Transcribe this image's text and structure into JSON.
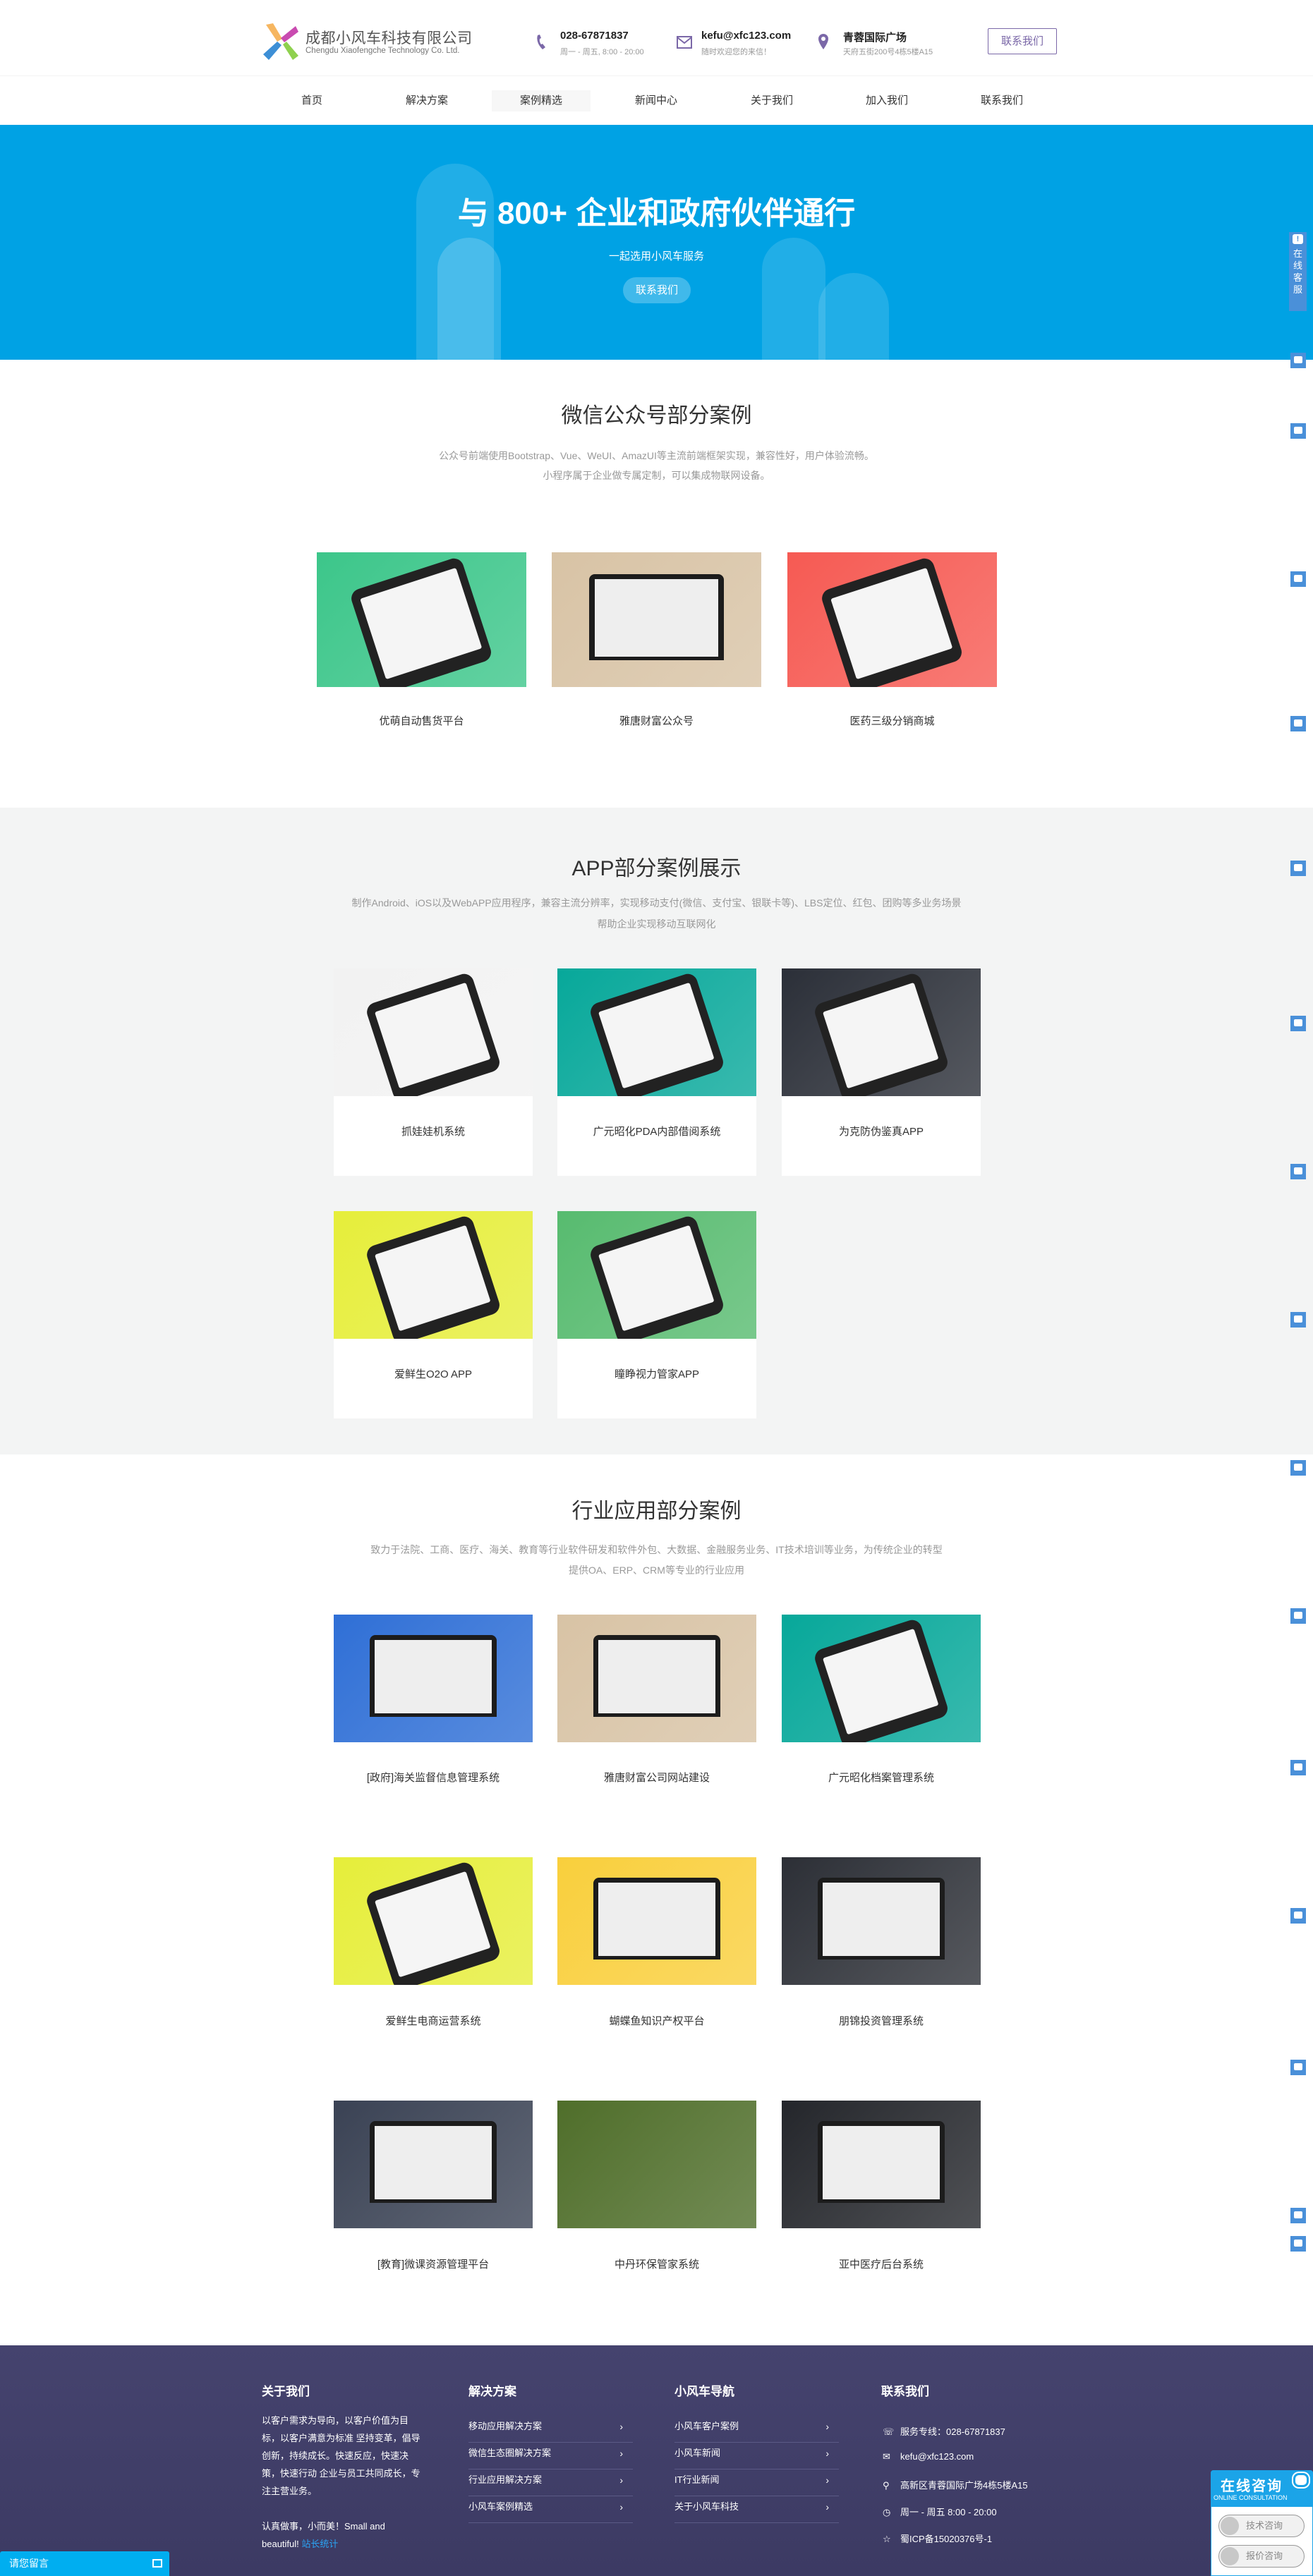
{
  "header": {
    "company_name": "成都小风车科技有限公司",
    "company_en": "Chengdu Xiaofengche Technology Co. Ltd.",
    "phone": "028-67871837",
    "phone_hours": "周一 - 周五, 8:00 - 20:00",
    "email": "kefu@xfc123.com",
    "email_note": "随时欢迎您的来信！",
    "location": "青蓉国际广场",
    "address": "天府五街200号4栋5楼A15",
    "contact_button": "联系我们"
  },
  "nav": {
    "items": [
      "首页",
      "解决方案",
      "案例精选",
      "新闻中心",
      "关于我们",
      "加入我们",
      "联系我们"
    ],
    "active_index": 2
  },
  "hero": {
    "title": "与 800+ 企业和政府伙伴通行",
    "subtitle": "一起选用小风车服务",
    "button": "联系我们"
  },
  "wechat_section": {
    "title": "微信公众号部分案例",
    "desc": [
      "公众号前端使用Bootstrap、Vue、WeUI、AmazUI等主流前端框架实现，兼容性好，用户体验流畅。",
      "小程序属于企业做专属定制，可以集成物联网设备。"
    ],
    "cases": [
      {
        "label": "优萌自动售货平台",
        "color": "#3cc68a",
        "style": "phone"
      },
      {
        "label": "雅唐财富公众号",
        "color": "#d8c3a5",
        "style": "laptop"
      },
      {
        "label": "医药三级分销商城",
        "color": "#f65a53",
        "style": "phone"
      }
    ]
  },
  "app_section": {
    "title": "APP部分案例展示",
    "desc": [
      "制作Android、iOS以及WebAPP应用程序，兼容主流分辨率，实现移动支付(微信、支付宝、银联卡等)、LBS定位、红包、团购等多业务场景",
      "帮助企业实现移动互联网化"
    ],
    "cases": [
      {
        "label": "抓娃娃机系统",
        "color": "#f2f2f2",
        "style": "phone"
      },
      {
        "label": "广元昭化PDA内部借阅系统",
        "color": "#07a89a",
        "style": "phone"
      },
      {
        "label": "为克防伪鉴真APP",
        "color": "#2b2f38",
        "style": "phone"
      },
      {
        "label": "爱鲜生O2O APP",
        "color": "#e6ee3a",
        "style": "phone"
      },
      {
        "label": "瞳睁视力管家APP",
        "color": "#57bb6f",
        "style": "phone"
      }
    ]
  },
  "industry_section": {
    "title": "行业应用部分案例",
    "desc": [
      "致力于法院、工商、医疗、海关、教育等行业软件研发和软件外包、大数据、金融服务业务、IT技术培训等业务，为传统企业的转型",
      "提供OA、ERP、CRM等专业的行业应用"
    ],
    "cases": [
      {
        "label": "[政府]海关监督信息管理系统",
        "color": "#2f6fd6",
        "style": "laptop"
      },
      {
        "label": "雅唐财富公司网站建设",
        "color": "#d8c3a5",
        "style": "laptop"
      },
      {
        "label": "广元昭化档案管理系统",
        "color": "#07a89a",
        "style": "phone"
      },
      {
        "label": "爱鲜生电商运营系统",
        "color": "#e6ee3a",
        "style": "phone"
      },
      {
        "label": "蝴蝶鱼知识产权平台",
        "color": "#f9cf3c",
        "style": "laptop"
      },
      {
        "label": "朋锦投资管理系统",
        "color": "#2c2f36",
        "style": "laptop"
      },
      {
        "label": "[教育]微课资源管理平台",
        "color": "#3a4254",
        "style": "laptop"
      },
      {
        "label": "中丹环保管家系统",
        "color": "#4f6e2a",
        "style": "none"
      },
      {
        "label": "亚中医疗后台系统",
        "color": "#24262b",
        "style": "laptop"
      }
    ]
  },
  "footer": {
    "about": {
      "title": "关于我们",
      "text": "以客户需求为导向，以客户价值为目标，以客户满意为标准 坚持变革，倡导创新，持续成长。快速反应，快速决策，快速行动 企业与员工共同成长，专注主营业务。",
      "motto": "认真做事，小而美！Small and beautiful!",
      "stat_link": "站长统计"
    },
    "solutions": {
      "title": "解决方案",
      "items": [
        "移动应用解决方案",
        "微信生态圈解决方案",
        "行业应用解决方案",
        "小风车案例精选"
      ]
    },
    "nav": {
      "title": "小风车导航",
      "items": [
        "小风车客户案例",
        "小风车新闻",
        "IT行业新闻",
        "关于小风车科技"
      ]
    },
    "contact": {
      "title": "联系我们",
      "items": [
        {
          "icon": "phone-icon",
          "glyph": "☏",
          "text": "服务专线：028-67871837"
        },
        {
          "icon": "mail-icon",
          "glyph": "✉",
          "text": "kefu@xfc123.com"
        },
        {
          "icon": "location-icon",
          "glyph": "⚲",
          "text": "高新区青蓉国际广场4栋5楼A15"
        },
        {
          "icon": "clock-icon",
          "glyph": "◷",
          "text": "周一 - 周五 8:00 - 20:00"
        },
        {
          "icon": "star-icon",
          "glyph": "☆",
          "text": "蜀ICP备15020376号-1"
        }
      ]
    }
  },
  "widgets": {
    "message_bar": "请您留言",
    "side_tab": "在线客服",
    "chat_title": "在线咨询",
    "chat_subtitle": "ONLINE CONSULTATION",
    "chat_buttons": [
      "技术咨询",
      "报价咨询"
    ]
  },
  "colors": {
    "hero": "#00a2e4",
    "accent": "#7b68a8",
    "footer": "#403f68",
    "link": "#2aa4f4"
  }
}
